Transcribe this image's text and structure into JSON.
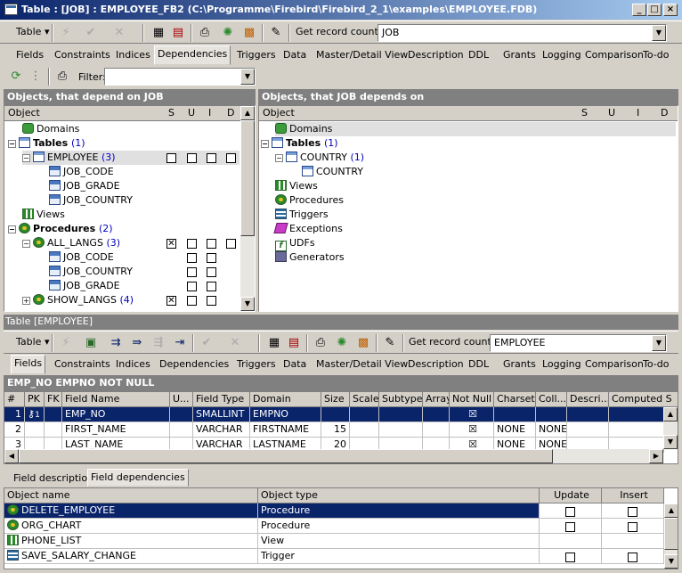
{
  "window": {
    "title": "Table : [JOB] : EMPLOYEE_FB2 (C:\\Programme\\Firebird\\Firebird_2_1\\examples\\EMPLOYEE.FDB)"
  },
  "top_toolbar": {
    "table_label": "Table",
    "get_record_count": "Get record count",
    "table_combo_value": "JOB"
  },
  "top_tabs": [
    "Fields",
    "Constraints",
    "Indices",
    "Dependencies",
    "Triggers",
    "Data",
    "Master/Detail View",
    "Description",
    "DDL",
    "Grants",
    "Logging",
    "Comparison",
    "To-do"
  ],
  "top_active_tab": "Dependencies",
  "filter": {
    "label": "Filter:",
    "value": ""
  },
  "left_panel": {
    "title": "Objects, that depend on JOB",
    "columns": [
      "Object",
      "S",
      "U",
      "I",
      "D"
    ],
    "rows": [
      {
        "label": "Domains",
        "icon": "domain-icon"
      },
      {
        "label": "Tables",
        "count": "(1)",
        "icon": "table-icon"
      },
      {
        "label": "EMPLOYEE",
        "count": "(3)",
        "icon": "table-icon"
      },
      {
        "label": "JOB_CODE",
        "icon": "field-icon"
      },
      {
        "label": "JOB_GRADE",
        "icon": "field-icon"
      },
      {
        "label": "JOB_COUNTRY",
        "icon": "field-icon"
      },
      {
        "label": "Views",
        "icon": "view-icon"
      },
      {
        "label": "Procedures",
        "count": "(2)",
        "icon": "procedure-icon"
      },
      {
        "label": "ALL_LANGS",
        "count": "(3)",
        "icon": "procedure-icon"
      },
      {
        "label": "JOB_CODE",
        "icon": "field-icon"
      },
      {
        "label": "JOB_COUNTRY",
        "icon": "field-icon"
      },
      {
        "label": "JOB_GRADE",
        "icon": "field-icon"
      },
      {
        "label": "SHOW_LANGS",
        "count": "(4)",
        "icon": "procedure-icon"
      }
    ]
  },
  "right_panel": {
    "title": "Objects, that JOB depends on",
    "columns": [
      "Object",
      "S",
      "U",
      "I",
      "D"
    ],
    "rows": [
      {
        "label": "Domains"
      },
      {
        "label": "Tables",
        "count": "(1)"
      },
      {
        "label": "COUNTRY",
        "count": "(1)"
      },
      {
        "label": "COUNTRY"
      },
      {
        "label": "Views"
      },
      {
        "label": "Procedures"
      },
      {
        "label": "Triggers"
      },
      {
        "label": "Exceptions"
      },
      {
        "label": "UDFs"
      },
      {
        "label": "Generators"
      }
    ]
  },
  "inner_window": {
    "title": "Table [EMPLOYEE]"
  },
  "inner_toolbar": {
    "table_label": "Table",
    "get_record_count": "Get record count",
    "table_combo_value": "EMPLOYEE"
  },
  "inner_tabs": [
    "Fields",
    "Constraints",
    "Indices",
    "Dependencies",
    "Triggers",
    "Data",
    "Master/Detail View",
    "Description",
    "DDL",
    "Grants",
    "Logging",
    "Comparison",
    "To-do"
  ],
  "inner_active_tab": "Fields",
  "constraint_header": "EMP_NO EMPNO NOT NULL",
  "fields_grid": {
    "columns": [
      "#",
      "PK",
      "FK",
      "Field Name",
      "U...",
      "Field Type",
      "Domain",
      "Size",
      "Scale",
      "Subtype",
      "Array",
      "Not Null",
      "Charset",
      "Coll...",
      "Descri...",
      "Computed S"
    ],
    "rows": [
      {
        "n": "1",
        "pk": "1",
        "name": "EMP_NO",
        "type": "SMALLINT",
        "domain": "EMPNO",
        "size": "",
        "notnull": "☒",
        "charset": "",
        "coll": ""
      },
      {
        "n": "2",
        "pk": "",
        "name": "FIRST_NAME",
        "type": "VARCHAR",
        "domain": "FIRSTNAME",
        "size": "15",
        "notnull": "☒",
        "charset": "NONE",
        "coll": "NONE"
      },
      {
        "n": "3",
        "pk": "",
        "name": "LAST_NAME",
        "type": "VARCHAR",
        "domain": "LASTNAME",
        "size": "20",
        "notnull": "☒",
        "charset": "NONE",
        "coll": "NONE"
      }
    ]
  },
  "bottom_tabs": [
    "Field description",
    "Field dependencies"
  ],
  "bottom_active_tab": "Field dependencies",
  "deps_grid": {
    "columns": [
      "Object name",
      "Object type",
      "Update",
      "Insert"
    ],
    "rows": [
      {
        "name": "DELETE_EMPLOYEE",
        "type": "Procedure",
        "icon": "procedure-icon"
      },
      {
        "name": "ORG_CHART",
        "type": "Procedure",
        "icon": "procedure-icon"
      },
      {
        "name": "PHONE_LIST",
        "type": "View",
        "icon": "view-icon"
      },
      {
        "name": "SAVE_SALARY_CHANGE",
        "type": "Trigger",
        "icon": "trigger-icon"
      }
    ]
  }
}
